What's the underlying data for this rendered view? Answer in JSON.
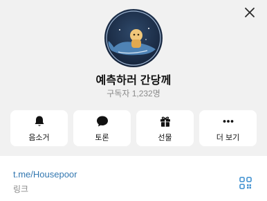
{
  "channel": {
    "name": "예측하러 간당께",
    "subscribers": "구독자 1,232명"
  },
  "actions": [
    {
      "label": "음소거",
      "icon": "bell-icon"
    },
    {
      "label": "토론",
      "icon": "chat-bubble-icon"
    },
    {
      "label": "선물",
      "icon": "gift-icon"
    },
    {
      "label": "더 보기",
      "icon": "more-dots-icon"
    }
  ],
  "info": {
    "link": "t.me/Housepoor",
    "link_caption": "링크"
  },
  "colors": {
    "background": "#f1f1f1",
    "card": "#ffffff",
    "link": "#3277b0",
    "muted_text": "#8a8a8a",
    "qr_accent": "#3d8fd0"
  }
}
